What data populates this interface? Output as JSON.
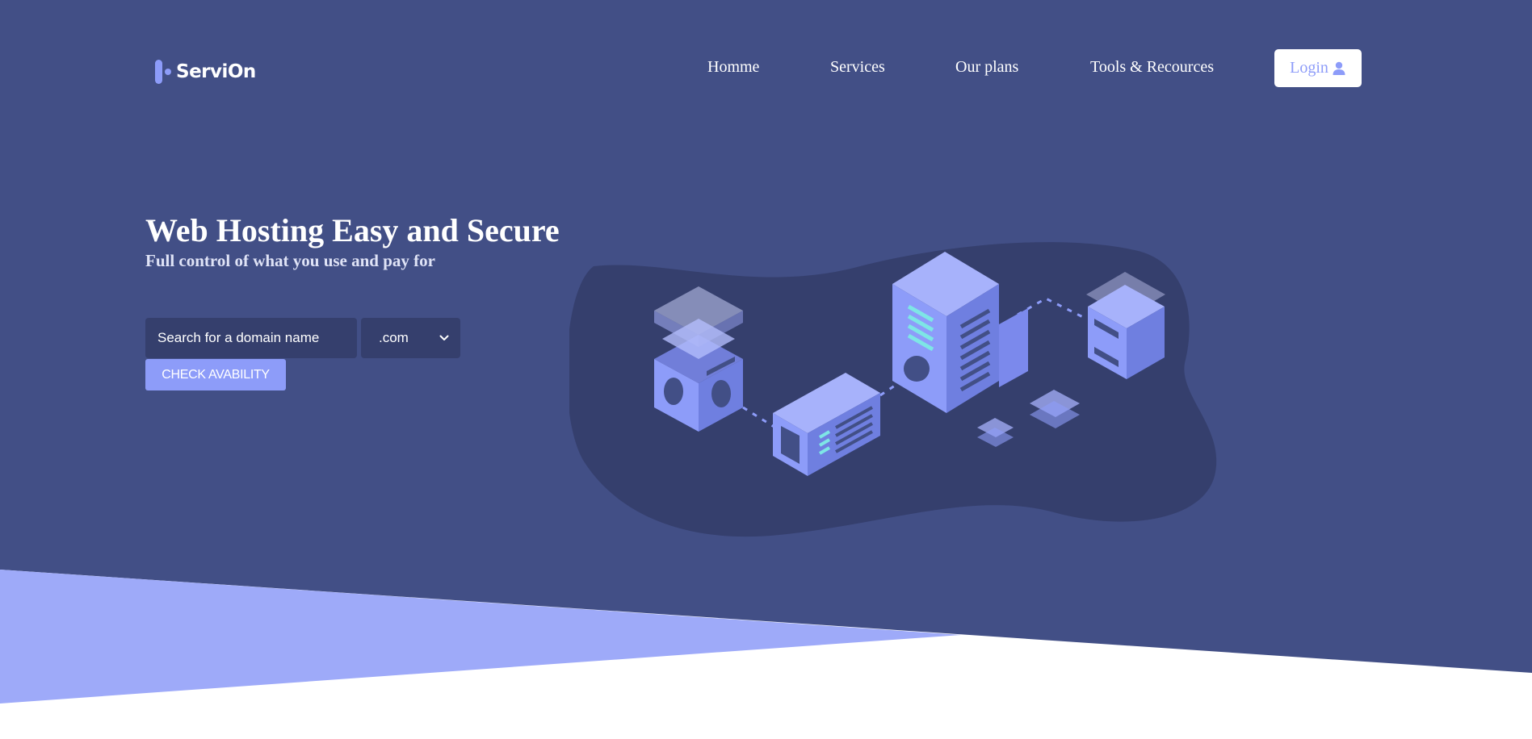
{
  "header": {
    "logo_text": "ServiOn",
    "nav": [
      {
        "label": "Homme"
      },
      {
        "label": "Services"
      },
      {
        "label": "Our plans"
      },
      {
        "label": "Tools & Recources"
      }
    ],
    "login_label": "Login",
    "login_icon": "user-icon"
  },
  "hero": {
    "title": "Web Hosting Easy and Secure",
    "subtitle": "Full control of what you use and pay for",
    "search_placeholder": "Search for a domain name",
    "tld_selected": ".com",
    "check_label": "CHECK AVABILITY",
    "illustration": "isometric-servers-illustration"
  },
  "colors": {
    "background": "#424f86",
    "accent": "#8d9cf9",
    "wedge": "#9eaaf9",
    "input_bg": "#353f6d",
    "blob": "#353f6d"
  }
}
